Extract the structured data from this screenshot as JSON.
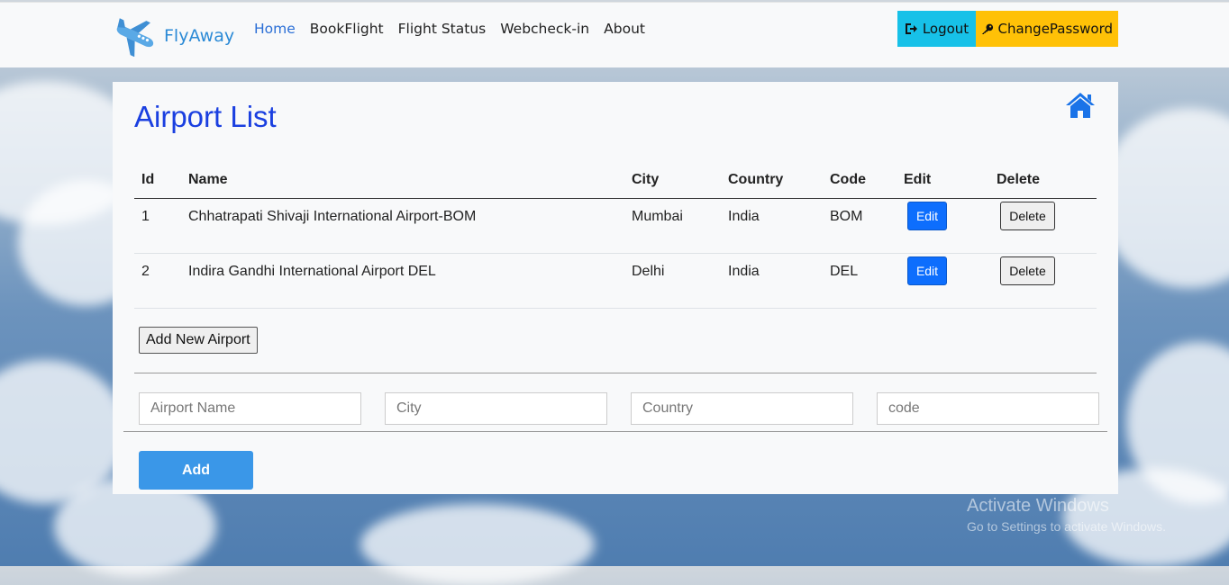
{
  "brand": {
    "name": "FlyAway",
    "icon": "airplane-icon"
  },
  "nav": {
    "items": [
      "Home",
      "BookFlight",
      "Flight Status",
      "Webcheck-in",
      "About"
    ],
    "active": "Home"
  },
  "header_actions": {
    "logout_label": "Logout",
    "logout_icon": "sign-out-icon",
    "change_password_label": "ChangePassword",
    "change_password_icon": "key-icon"
  },
  "page": {
    "title": "Airport List",
    "home_icon": "home-icon"
  },
  "table": {
    "columns": [
      "Id",
      "Name",
      "City",
      "Country",
      "Code",
      "Edit",
      "Delete"
    ],
    "rows": [
      {
        "id": "1",
        "name": "Chhatrapati Shivaji International Airport-BOM",
        "city": "Mumbai",
        "country": "India",
        "code": "BOM",
        "edit": "Edit",
        "delete": "Delete"
      },
      {
        "id": "2",
        "name": "Indira Gandhi International Airport DEL",
        "city": "Delhi",
        "country": "India",
        "code": "DEL",
        "edit": "Edit",
        "delete": "Delete"
      }
    ]
  },
  "add_new_label": "Add New Airport",
  "form": {
    "name_placeholder": "Airport Name",
    "city_placeholder": "City",
    "country_placeholder": "Country",
    "code_placeholder": "code",
    "add_label": "Add"
  },
  "watermark": {
    "line1": "Activate Windows",
    "line2": "Go to Settings to activate Windows."
  },
  "colors": {
    "brand": "#2b8ad6",
    "title": "#1a3fe0",
    "logout": "#17c1e8",
    "change_password": "#ffc107",
    "edit": "#0d6efd",
    "add": "#3a97e8"
  }
}
